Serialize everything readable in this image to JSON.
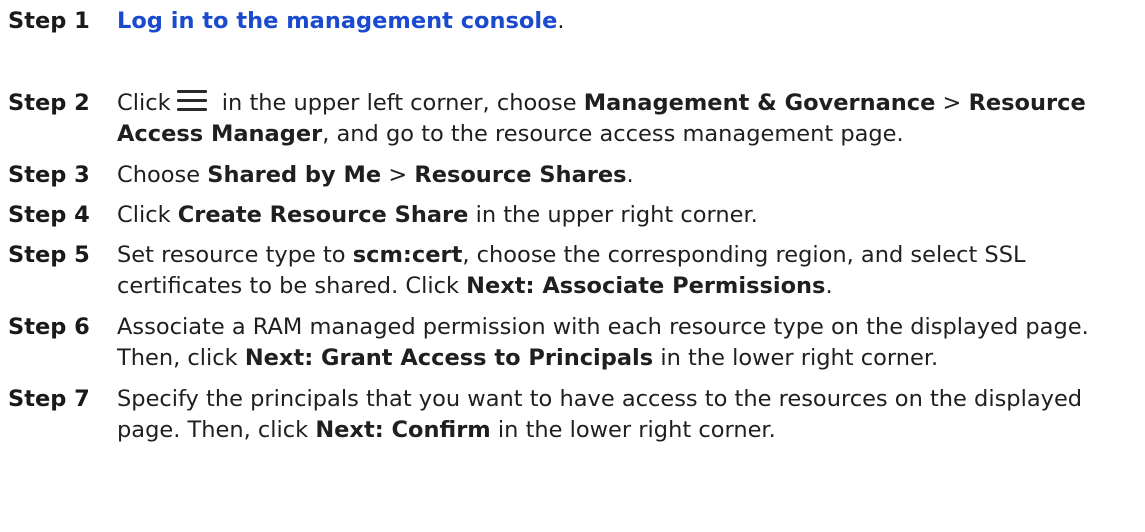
{
  "steps": [
    {
      "label": "Step 1",
      "link": "Log in to the management console",
      "end": "."
    },
    {
      "label": "Step 2",
      "t1": "Click",
      "icon": "menu-icon",
      "t2": " in the upper left corner, choose ",
      "b1": "Management & Governance",
      "t3": " > ",
      "b2": "Resource Access Manager",
      "t4": ", and go to the resource access management page."
    },
    {
      "label": "Step 3",
      "t1": "Choose ",
      "b1": "Shared by Me",
      "t2": " > ",
      "b2": "Resource Shares",
      "t3": "."
    },
    {
      "label": "Step 4",
      "t1": "Click ",
      "b1": "Create Resource Share",
      "t2": " in the upper right corner."
    },
    {
      "label": "Step 5",
      "t1": "Set resource type to ",
      "b1": "scm:cert",
      "t2": ", choose the corresponding region, and select SSL certificates to be shared. Click ",
      "b2": "Next: Associate Permissions",
      "t3": "."
    },
    {
      "label": "Step 6",
      "t1": "Associate a RAM managed permission with each resource type on the displayed page. Then, click ",
      "b1": "Next: Grant Access to Principals",
      "t2": " in the lower right corner."
    },
    {
      "label": "Step 7",
      "t1": "Specify the principals that you want to have access to the resources on the displayed page. Then, click ",
      "b1": "Next: Confirm",
      "t2": " in the lower right corner."
    }
  ]
}
